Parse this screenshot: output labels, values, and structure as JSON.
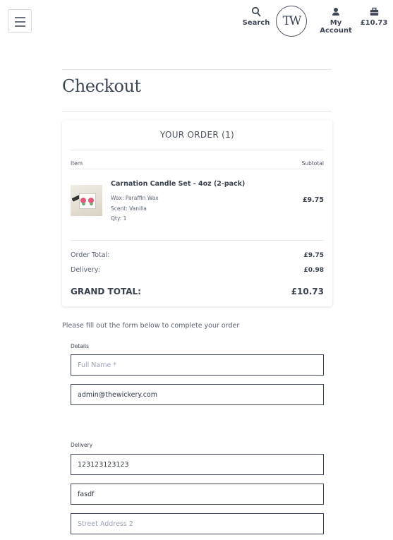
{
  "header": {
    "menu_icon": "hamburger-icon",
    "search_label": "Search",
    "logo_text": "TW",
    "account_label": "My Account",
    "cart_label": "£10.73"
  },
  "page": {
    "title": "Checkout"
  },
  "order": {
    "title": "YOUR ORDER (1)",
    "col_item": "Item",
    "col_subtotal": "Subtotal",
    "items": [
      {
        "name": "Carnation Candle Set - 4oz (2-pack)",
        "wax": "Wax: Paraffin Wax",
        "scent": "Scent: Vanilla",
        "qty": "Qty: 1",
        "price": "£9.75"
      }
    ],
    "order_total_label": "Order Total:",
    "order_total_value": "£9.75",
    "delivery_label": "Delivery:",
    "delivery_value": "£0.98",
    "grand_total_label": "GRAND TOTAL:",
    "grand_total_value": "£10.73"
  },
  "form": {
    "intro": "Please fill out the form below to complete your order",
    "details_label": "Details",
    "full_name_placeholder": "Full Name *",
    "full_name_value": "",
    "email_value": "admin@thewickery.com",
    "delivery_label": "Delivery",
    "phone_value": "123123123123",
    "address1_value": "fasdf",
    "address2_placeholder": "Street Address 2",
    "address2_value": ""
  }
}
